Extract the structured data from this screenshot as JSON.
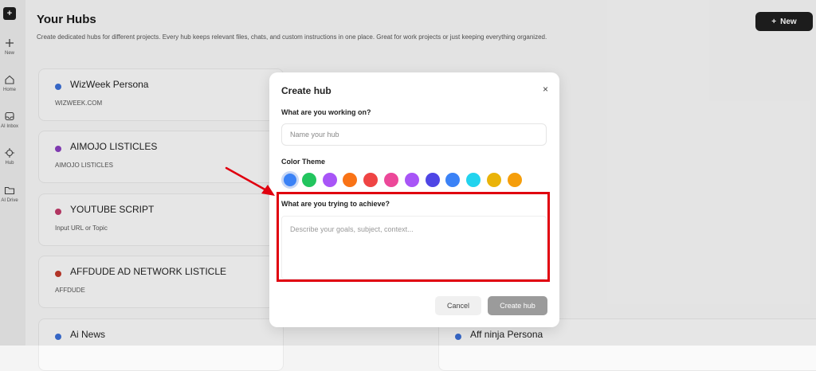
{
  "sidebar": {
    "logo": "+",
    "items": [
      {
        "label": "New",
        "icon": "plus-icon"
      },
      {
        "label": "Home",
        "icon": "home-icon"
      },
      {
        "label": "AI Inbox",
        "icon": "inbox-icon"
      },
      {
        "label": "Hub",
        "icon": "hub-icon"
      },
      {
        "label": "AI Drive",
        "icon": "folder-icon"
      }
    ]
  },
  "header": {
    "title": "Your Hubs",
    "subtitle": "Create dedicated hubs for different projects. Every hub keeps relevant files, chats, and custom instructions in one place. Great for work projects or just keeping everything organized.",
    "new_label": "New"
  },
  "hubs_left": [
    {
      "title": "WizWeek Persona",
      "subtitle": "WIZWEEK.COM",
      "color": "#3b6fd6"
    },
    {
      "title": "AIMOJO LISTICLES",
      "subtitle": "AIMOJO LISTICLES",
      "color": "#8a3fbf"
    },
    {
      "title": "YOUTUBE SCRIPT",
      "subtitle": "Input  URL or Topic",
      "color": "#c03a6a"
    },
    {
      "title": "AFFDUDE AD NETWORK LISTICLE",
      "subtitle": "AFFDUDE",
      "color": "#c0392b"
    },
    {
      "title": "Ai News",
      "subtitle": "",
      "color": "#3b6fd6"
    }
  ],
  "hubs_right": [
    {
      "title": "Aff ninja Persona",
      "color": "#3b6fd6"
    }
  ],
  "modal": {
    "title": "Create hub",
    "close": "×",
    "name_label": "What are you working on?",
    "name_placeholder": "Name your hub",
    "color_label": "Color Theme",
    "colors": [
      "#3b82f6",
      "#22c55e",
      "#a855f7",
      "#f97316",
      "#ef4444",
      "#ec4899",
      "#a855f7",
      "#4f46e5",
      "#3b82f6",
      "#22d3ee",
      "#eab308",
      "#f59e0b"
    ],
    "selected_color_index": 0,
    "goal_label": "What are you trying to achieve?",
    "goal_placeholder": "Describe your goals, subject, context...",
    "cancel_label": "Cancel",
    "create_label": "Create hub"
  },
  "annotation": {
    "highlight_color": "#e0000f"
  }
}
